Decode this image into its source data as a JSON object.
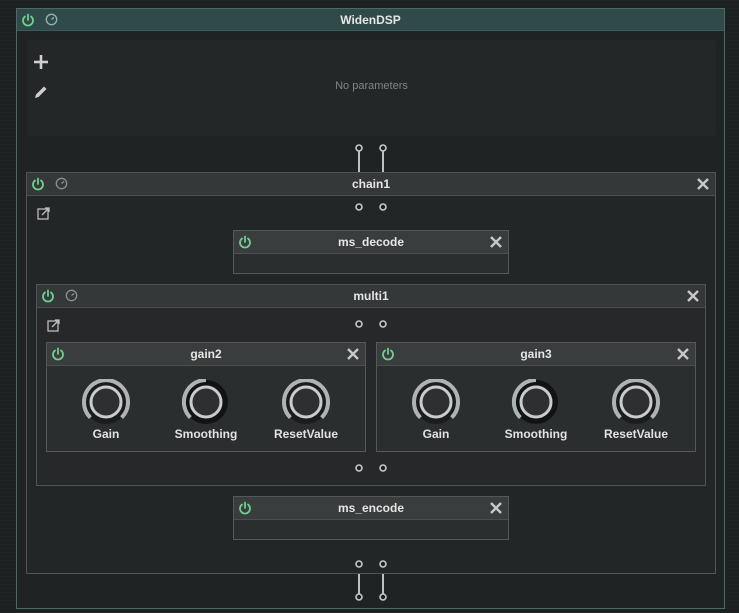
{
  "root": {
    "title": "WidenDSP",
    "no_params_text": "No parameters"
  },
  "chain1": {
    "title": "chain1"
  },
  "ms_decode": {
    "title": "ms_decode"
  },
  "multi1": {
    "title": "multi1"
  },
  "gain2": {
    "title": "gain2",
    "knobs": [
      "Gain",
      "Smoothing",
      "ResetValue"
    ]
  },
  "gain3": {
    "title": "gain3",
    "knobs": [
      "Gain",
      "Smoothing",
      "ResetValue"
    ]
  },
  "ms_encode": {
    "title": "ms_encode"
  },
  "icons": {
    "power": "power-icon",
    "clock": "clock-icon",
    "add": "plus-icon",
    "edit": "pencil-icon",
    "close": "close-icon",
    "popout": "external-link-icon"
  },
  "colors": {
    "power_green": "#6fcf8e",
    "header_teal": "#2f4a48"
  }
}
